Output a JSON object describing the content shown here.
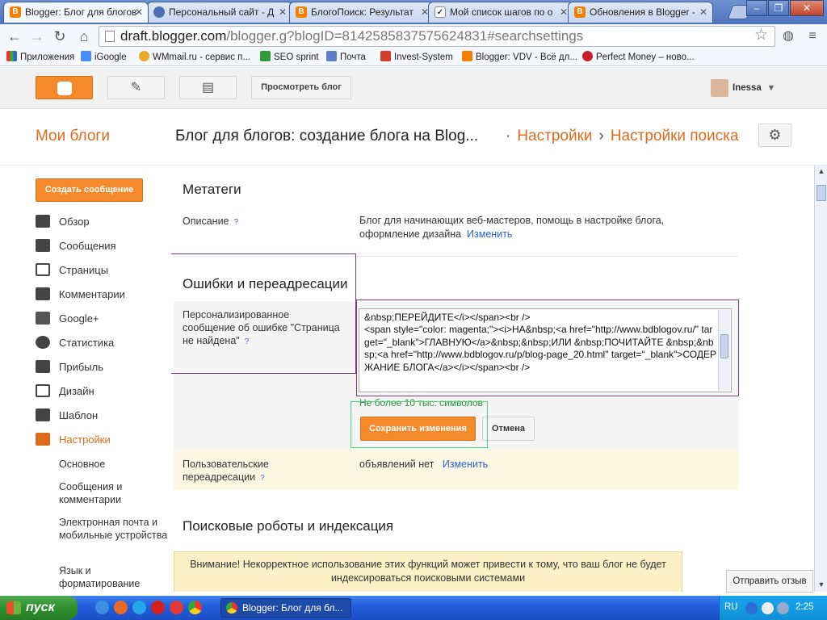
{
  "browser": {
    "tabs": [
      {
        "title": "Blogger: Блог для блогов",
        "icon": "blogger-favicon"
      },
      {
        "title": "Персональный сайт - Д",
        "icon": "site-favicon"
      },
      {
        "title": "БлогоПоиск: Результат",
        "icon": "blogger-favicon"
      },
      {
        "title": "Мой список шагов по о",
        "icon": "steps-favicon"
      },
      {
        "title": "Обновления в Blogger -",
        "icon": "blogger-favicon"
      }
    ],
    "url_host": "draft.blogger.com",
    "url_rest": "/blogger.g?blogID=8142585837575624831#searchsettings",
    "bookmarks": [
      "Приложения",
      "iGoogle",
      "WMmail.ru - сервис п...",
      "SEO sprint",
      "Почта",
      "Invest-System",
      "Blogger: VDV - Всё дл...",
      "Perfect Money – ново..."
    ]
  },
  "header": {
    "view_blog_label": "Просмотреть блог",
    "user_name": "Inessa"
  },
  "title_row": {
    "my_blogs": "Мои блоги",
    "blog_title": "Блог для блогов: создание блога на Blog...",
    "crumb_settings": "Настройки",
    "crumb_search": "Настройки поиска"
  },
  "sidebar": {
    "new_post_label": "Создать сообщение",
    "items": [
      {
        "label": "Обзор",
        "icon": "home-icon"
      },
      {
        "label": "Сообщения",
        "icon": "posts-icon"
      },
      {
        "label": "Страницы",
        "icon": "pages-icon"
      },
      {
        "label": "Комментарии",
        "icon": "comments-icon"
      },
      {
        "label": "Google+",
        "icon": "google-plus-icon"
      },
      {
        "label": "Статистика",
        "icon": "stats-icon"
      },
      {
        "label": "Прибыль",
        "icon": "trophy-icon"
      },
      {
        "label": "Дизайн",
        "icon": "layout-icon"
      },
      {
        "label": "Шаблон",
        "icon": "template-icon"
      },
      {
        "label": "Настройки",
        "icon": "wrench-icon"
      }
    ],
    "subitems": [
      "Основное",
      "Сообщения и комментарии",
      "Электронная почта и мобильные устройства",
      "Язык и форматирование"
    ]
  },
  "main": {
    "meta_heading": "Метатеги",
    "desc_label": "Описание",
    "desc_value": "Блог для начинающих веб-мастеров, помощь в настройке блога, оформление дизайна",
    "edit_label": "Изменить",
    "errors_heading": "Ошибки и переадресации",
    "error_label": "Персонализированное сообщение об ошибке \"Страница не найдена\"",
    "error_text": "&nbsp;ПЕРЕЙДИТЕ</i></span><br />\n<span style=\"color: magenta;\"><i>НА&nbsp;<a href=\"http://www.bdblogov.ru/\" target=\"_blank\">ГЛАВНУЮ</a>&nbsp;&nbsp;ИЛИ &nbsp;ПОЧИТАЙТЕ &nbsp;&nbsp;<a href=\"http://www.bdblogov.ru/p/blog-page_20.html\" target=\"_blank\">СОДЕРЖАНИЕ БЛОГА</a></i></span><br />",
    "char_limit": "Не более 10 тыс. символов",
    "save_label": "Сохранить изменения",
    "cancel_label": "Отмена",
    "redirects_label": "Пользовательские переадресации",
    "redirects_value": "объявлений нет",
    "redirects_edit": "Изменить",
    "robots_heading": "Поисковые роботы и индексация",
    "warning": "Внимание! Некорректное использование этих функций может привести к тому, что ваш блог не будет индексироваться поисковыми системами",
    "help_mark": "?"
  },
  "feedback_label": "Отправить отзыв",
  "taskbar": {
    "start_label": "пуск",
    "task_title": "Blogger: Блог для бл...",
    "lang": "RU",
    "clock": "2:25"
  }
}
